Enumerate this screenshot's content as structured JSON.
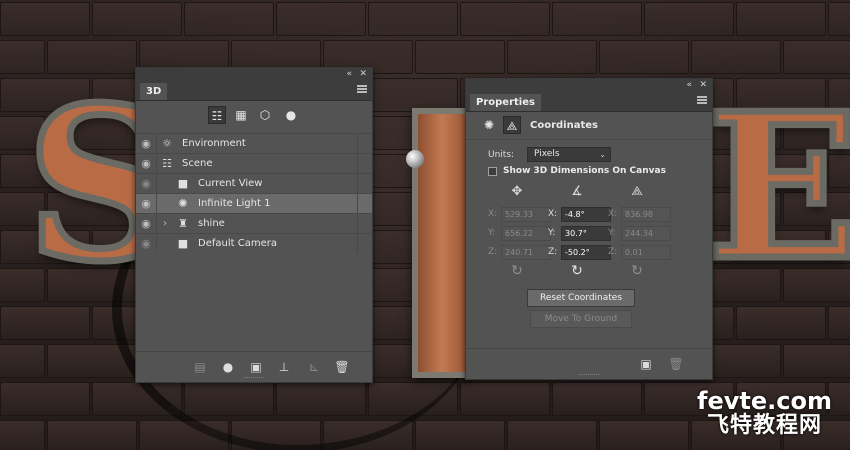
{
  "canvas": {
    "artwork_letters": [
      "S",
      "H",
      "E"
    ],
    "watermark": {
      "line1": "fevte.com",
      "line2": "飞特教程网"
    }
  },
  "panel_3d": {
    "tab_title": "3D",
    "collapse_icon": "double-chevron-left-icon",
    "close_icon": "close-icon",
    "filters": [
      {
        "name": "filter-whole-scene",
        "icon": "scene-tree-icon",
        "glyph": "☷",
        "active": true
      },
      {
        "name": "filter-meshes",
        "icon": "mesh-icon",
        "glyph": "▦",
        "active": false
      },
      {
        "name": "filter-materials",
        "icon": "material-icon",
        "glyph": "⬡",
        "active": false
      },
      {
        "name": "filter-lights",
        "icon": "light-bulb-icon",
        "glyph": "●",
        "active": false
      }
    ],
    "scene_items": [
      {
        "label": "Environment",
        "icon": "environment-icon",
        "glyph": "☼",
        "indent": 0,
        "selected": false,
        "dimmed": false,
        "expand": false
      },
      {
        "label": "Scene",
        "icon": "scene-tree-icon",
        "glyph": "☷",
        "indent": 0,
        "selected": false,
        "dimmed": false,
        "expand": false
      },
      {
        "label": "Current View",
        "icon": "camera-icon",
        "glyph": "■",
        "indent": 1,
        "selected": false,
        "dimmed": true,
        "expand": false
      },
      {
        "label": "Infinite Light 1",
        "icon": "infinite-light-icon",
        "glyph": "✺",
        "indent": 1,
        "selected": true,
        "dimmed": false,
        "expand": false
      },
      {
        "label": "shine",
        "icon": "mesh-object-icon",
        "glyph": "♜",
        "indent": 1,
        "selected": false,
        "dimmed": false,
        "expand": true
      },
      {
        "label": "Default Camera",
        "icon": "camera-icon",
        "glyph": "■",
        "indent": 1,
        "selected": false,
        "dimmed": true,
        "expand": false
      }
    ],
    "footer_buttons": [
      {
        "name": "render-button",
        "icon": "render-icon",
        "glyph": "▤",
        "disabled": true
      },
      {
        "name": "new-light-button",
        "icon": "light-bulb-icon",
        "glyph": "●",
        "disabled": false
      },
      {
        "name": "add-material-button",
        "icon": "material-icon",
        "glyph": "▣",
        "disabled": false
      },
      {
        "name": "drop-to-ground-button",
        "icon": "ground-icon",
        "glyph": "⊥",
        "disabled": false
      },
      {
        "name": "add-constraint-button",
        "icon": "constraint-icon",
        "glyph": "⊾",
        "disabled": true
      },
      {
        "name": "delete-button",
        "icon": "trash-icon",
        "glyph": "🗑",
        "disabled": false
      }
    ]
  },
  "panel_properties": {
    "tab_title": "Properties",
    "collapse_icon": "double-chevron-left-icon",
    "close_icon": "close-icon",
    "section_title": "Coordinates",
    "header_icons": [
      {
        "name": "infinite-light-icon",
        "glyph": "✺",
        "active": false
      },
      {
        "name": "coordinates-icon",
        "glyph": "⟁",
        "active": true
      }
    ],
    "units_label": "Units:",
    "units_value": "Pixels",
    "show_dims_label": "Show 3D Dimensions On Canvas",
    "columns": [
      {
        "name": "position",
        "icon": "move-arrows-icon",
        "glyph": "✥",
        "fields": [
          {
            "axis": "X:",
            "value": "529.33",
            "active": false
          },
          {
            "axis": "Y:",
            "value": "656.22",
            "active": false
          },
          {
            "axis": "Z:",
            "value": "240.71",
            "active": false
          }
        ],
        "reset_glyph": "↻",
        "reset_active": false
      },
      {
        "name": "rotation",
        "icon": "rotate-angle-icon",
        "glyph": "∡",
        "fields": [
          {
            "axis": "X:",
            "value": "-4.8°",
            "active": true
          },
          {
            "axis": "Y:",
            "value": "30.7°",
            "active": true
          },
          {
            "axis": "Z:",
            "value": "-50.2°",
            "active": true
          }
        ],
        "reset_glyph": "↻",
        "reset_active": true
      },
      {
        "name": "scale",
        "icon": "scale-icon",
        "glyph": "⟁",
        "fields": [
          {
            "axis": "X:",
            "value": "836.98",
            "active": false
          },
          {
            "axis": "Y:",
            "value": "244.34",
            "active": false
          },
          {
            "axis": "Z:",
            "value": "0.01",
            "active": false
          }
        ],
        "reset_glyph": "↻",
        "reset_active": false
      }
    ],
    "reset_button": "Reset Coordinates",
    "ground_button": "Move To Ground",
    "footer_buttons": [
      {
        "name": "material-icon",
        "glyph": "▣",
        "disabled": false
      },
      {
        "name": "trash-icon",
        "glyph": "🗑",
        "disabled": true
      }
    ]
  }
}
